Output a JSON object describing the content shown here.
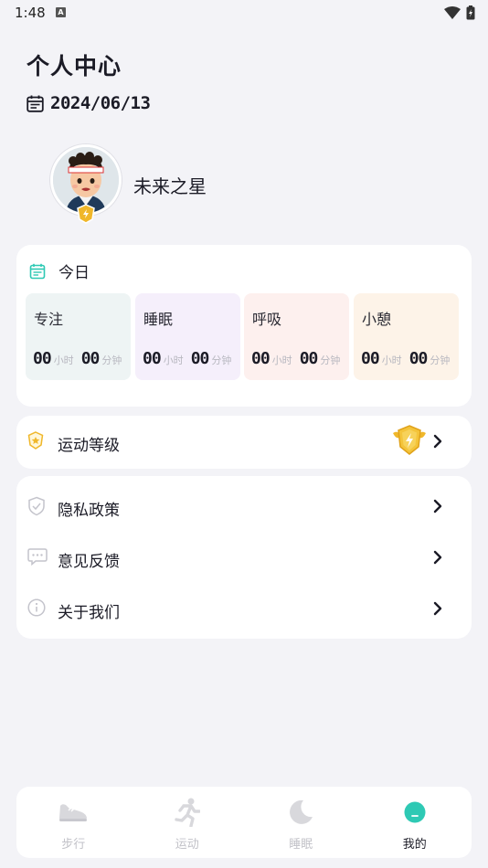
{
  "status_bar": {
    "time": "1:48",
    "notif_letter": "A"
  },
  "header": {
    "title": "个人中心",
    "date": "2024/06/13"
  },
  "user": {
    "name": "未来之星"
  },
  "today": {
    "label": "今日",
    "stats": [
      {
        "title": "专注",
        "hours": "00",
        "hour_unit": "小时",
        "minutes": "00",
        "minute_unit": "分钟",
        "bg": "#eef4f4"
      },
      {
        "title": "睡眠",
        "hours": "00",
        "hour_unit": "小时",
        "minutes": "00",
        "minute_unit": "分钟",
        "bg": "#f5effb"
      },
      {
        "title": "呼吸",
        "hours": "00",
        "hour_unit": "小时",
        "minutes": "00",
        "minute_unit": "分钟",
        "bg": "#fdf0ee"
      },
      {
        "title": "小憩",
        "hours": "00",
        "hour_unit": "小时",
        "minutes": "00",
        "minute_unit": "分钟",
        "bg": "#fdf3e8"
      }
    ]
  },
  "level": {
    "label": "运动等级"
  },
  "menu": {
    "items": [
      {
        "label": "隐私政策",
        "icon": "shield-check-icon"
      },
      {
        "label": "意见反馈",
        "icon": "chat-bubble-icon"
      },
      {
        "label": "关于我们",
        "icon": "info-icon"
      }
    ]
  },
  "tabbar": {
    "tabs": [
      {
        "label": "步行",
        "icon": "shoe-icon",
        "active": false
      },
      {
        "label": "运动",
        "icon": "runner-icon",
        "active": false
      },
      {
        "label": "睡眠",
        "icon": "moon-icon",
        "active": false
      },
      {
        "label": "我的",
        "icon": "smile-face-icon",
        "active": true
      }
    ]
  },
  "colors": {
    "accent": "#2ec9b4",
    "gold": "#f0b72a",
    "background": "#f3f3f7"
  }
}
